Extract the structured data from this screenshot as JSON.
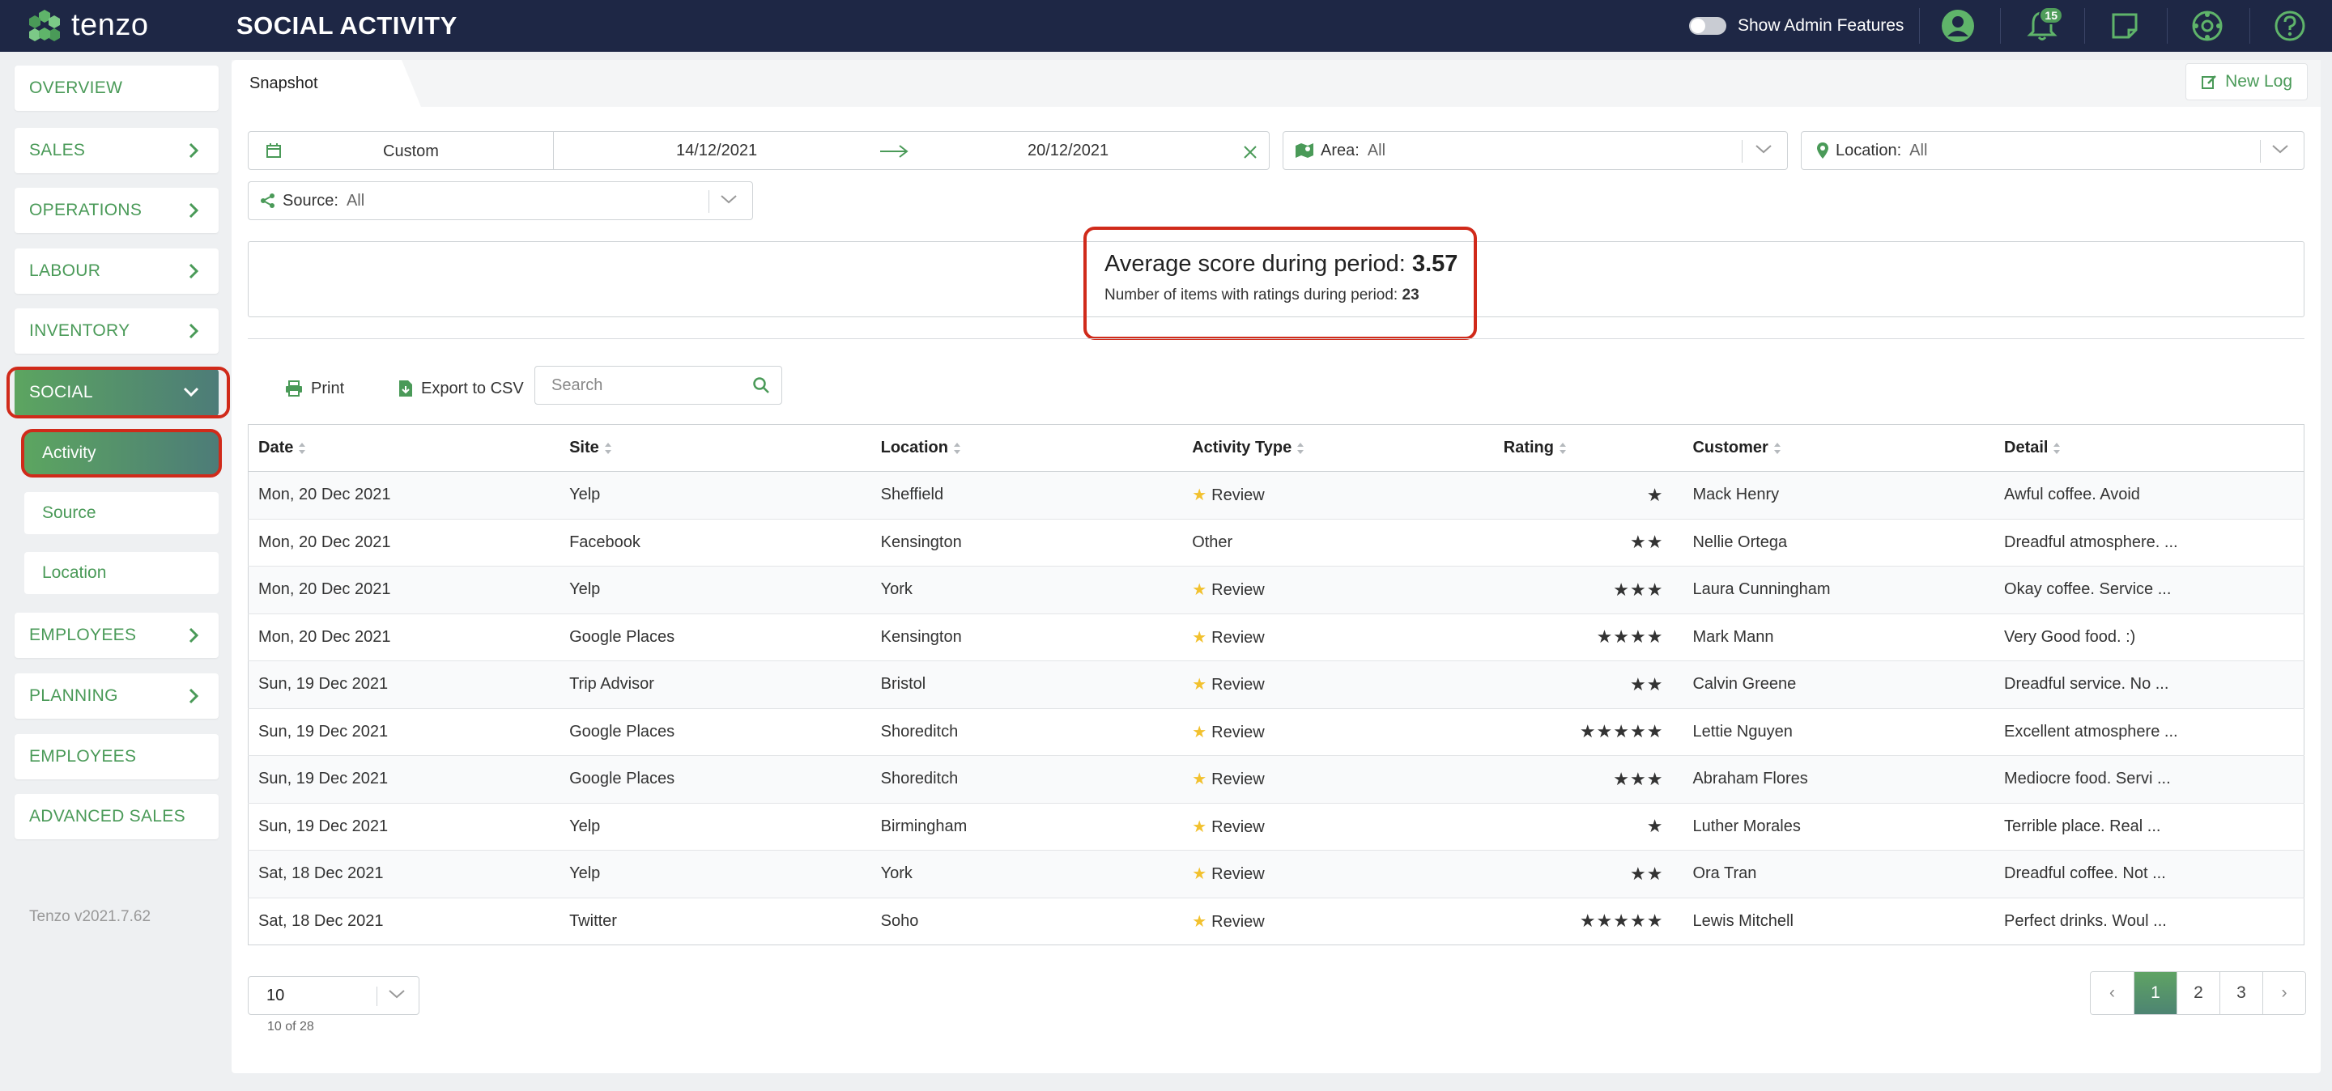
{
  "app": {
    "logo_text": "tenzo",
    "title": "SOCIAL ACTIVITY",
    "admin_label": "Show Admin Features",
    "notification_count": "15",
    "brand_color": "#4a9a58",
    "topbar_color": "#1e2745",
    "highlight_color": "#d02a1a"
  },
  "topbar_icons": [
    "user-icon",
    "bell-icon",
    "note-icon",
    "settings-icon",
    "help-icon"
  ],
  "sidebar": {
    "items": [
      {
        "label": "OVERVIEW",
        "chevron": false
      },
      {
        "label": "SALES",
        "chevron": true
      },
      {
        "label": "OPERATIONS",
        "chevron": true
      },
      {
        "label": "LABOUR",
        "chevron": true
      },
      {
        "label": "INVENTORY",
        "chevron": true
      },
      {
        "label": "SOCIAL",
        "chevron": "down",
        "active": true
      },
      {
        "label": "EMPLOYEES",
        "chevron": true
      },
      {
        "label": "PLANNING",
        "chevron": true
      },
      {
        "label": "EMPLOYEES",
        "chevron": false
      },
      {
        "label": "ADVANCED SALES",
        "chevron": false
      }
    ],
    "sub_items": [
      {
        "label": "Activity",
        "active": true
      },
      {
        "label": "Source"
      },
      {
        "label": "Location"
      }
    ],
    "version": "Tenzo v2021.7.62"
  },
  "main": {
    "tab_label": "Snapshot",
    "new_log_label": "New Log",
    "filters": {
      "range_type": "Custom",
      "start_date": "14/12/2021",
      "end_date": "20/12/2021",
      "area_label": "Area:",
      "area_value": "All",
      "location_label": "Location:",
      "location_value": "All",
      "source_label": "Source:",
      "source_value": "All"
    },
    "summary": {
      "avg_label": "Average score during period:",
      "avg_value": "3.57",
      "count_label": "Number of items with ratings during period:",
      "count_value": "23"
    },
    "toolbar": {
      "print_label": "Print",
      "export_label": "Export to CSV",
      "search_placeholder": "Search"
    },
    "table": {
      "columns": [
        "Date",
        "Site",
        "Location",
        "Activity Type",
        "Rating",
        "Customer",
        "Detail"
      ],
      "rows": [
        {
          "date": "Mon, 20 Dec 2021",
          "site": "Yelp",
          "location": "Sheffield",
          "type": "Review",
          "type_star": true,
          "rating": 1,
          "customer": "Mack Henry",
          "detail": "Awful coffee. Avoid"
        },
        {
          "date": "Mon, 20 Dec 2021",
          "site": "Facebook",
          "location": "Kensington",
          "type": "Other",
          "type_star": false,
          "rating": 2,
          "customer": "Nellie Ortega",
          "detail": "Dreadful atmosphere. ..."
        },
        {
          "date": "Mon, 20 Dec 2021",
          "site": "Yelp",
          "location": "York",
          "type": "Review",
          "type_star": true,
          "rating": 3,
          "customer": "Laura Cunningham",
          "detail": "Okay coffee. Service ..."
        },
        {
          "date": "Mon, 20 Dec 2021",
          "site": "Google Places",
          "location": "Kensington",
          "type": "Review",
          "type_star": true,
          "rating": 4,
          "customer": "Mark Mann",
          "detail": "Very Good food. :)"
        },
        {
          "date": "Sun, 19 Dec 2021",
          "site": "Trip Advisor",
          "location": "Bristol",
          "type": "Review",
          "type_star": true,
          "rating": 2,
          "customer": "Calvin Greene",
          "detail": "Dreadful service. No ..."
        },
        {
          "date": "Sun, 19 Dec 2021",
          "site": "Google Places",
          "location": "Shoreditch",
          "type": "Review",
          "type_star": true,
          "rating": 5,
          "customer": "Lettie Nguyen",
          "detail": "Excellent atmosphere ..."
        },
        {
          "date": "Sun, 19 Dec 2021",
          "site": "Google Places",
          "location": "Shoreditch",
          "type": "Review",
          "type_star": true,
          "rating": 3,
          "customer": "Abraham Flores",
          "detail": "Mediocre food. Servi ..."
        },
        {
          "date": "Sun, 19 Dec 2021",
          "site": "Yelp",
          "location": "Birmingham",
          "type": "Review",
          "type_star": true,
          "rating": 1,
          "customer": "Luther Morales",
          "detail": "Terrible place. Real ..."
        },
        {
          "date": "Sat, 18 Dec 2021",
          "site": "Yelp",
          "location": "York",
          "type": "Review",
          "type_star": true,
          "rating": 2,
          "customer": "Ora Tran",
          "detail": "Dreadful coffee. Not ..."
        },
        {
          "date": "Sat, 18 Dec 2021",
          "site": "Twitter",
          "location": "Soho",
          "type": "Review",
          "type_star": true,
          "rating": 5,
          "customer": "Lewis Mitchell",
          "detail": "Perfect drinks. Woul ..."
        }
      ]
    },
    "pagination": {
      "page_size": "10",
      "count_text": "10 of 28",
      "prev": "‹",
      "pages": [
        "1",
        "2",
        "3"
      ],
      "current": "1",
      "next": "›"
    }
  }
}
